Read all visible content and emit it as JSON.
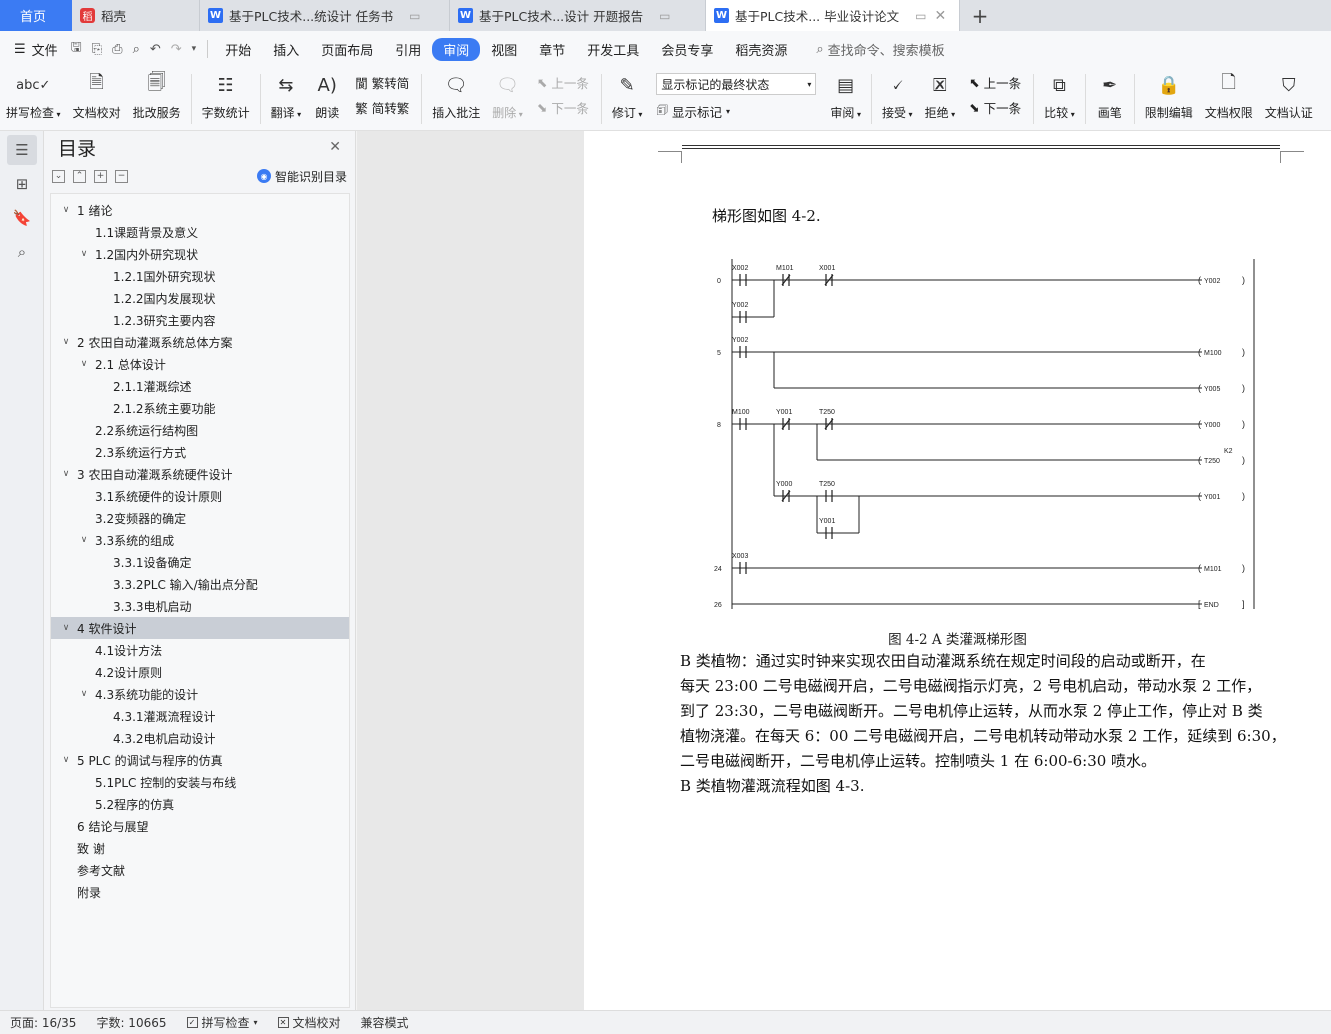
{
  "tabs": {
    "home": "首页",
    "daoke": "稻壳",
    "doc1": "基于PLC技术...统设计 任务书",
    "doc2": "基于PLC技术...设计 开题报告",
    "doc3": "基于PLC技术... 毕业设计论文",
    "new_tab": "+"
  },
  "menu": {
    "file": "文件",
    "items": [
      "开始",
      "插入",
      "页面布局",
      "引用",
      "审阅",
      "视图",
      "章节",
      "开发工具",
      "会员专享",
      "稻壳资源"
    ],
    "active": "审阅",
    "search": "查找命令、搜索模板"
  },
  "ribbon": {
    "spell": "拼写检查",
    "proof": "文档校对",
    "review_service": "批改服务",
    "word_count": "字数统计",
    "translate": "翻译",
    "read_aloud": "朗读",
    "trad_to_simp": "繁转简",
    "simp_to_trad": "简转繁",
    "insert_comment": "插入批注",
    "delete": "删除",
    "prev": "上一条",
    "next": "下一条",
    "track": "修订",
    "display_state": "显示标记的最终状态",
    "show_markup": "显示标记",
    "review": "审阅",
    "accept": "接受",
    "reject": "拒绝",
    "prev2": "上一条",
    "next2": "下一条",
    "compare": "比较",
    "pen": "画笔",
    "restrict": "限制编辑",
    "permission": "文档权限",
    "certify": "文档认证"
  },
  "toc": {
    "title": "目录",
    "smart": "智能识别目录",
    "items": [
      {
        "text": "1   绪论",
        "level": 0,
        "chev": true
      },
      {
        "text": "1.1课题背景及意义",
        "level": 1,
        "chev": false
      },
      {
        "text": "1.2国内外研究现状",
        "level": 1,
        "chev": true
      },
      {
        "text": "1.2.1国外研究现状",
        "level": 2,
        "chev": false
      },
      {
        "text": "1.2.2国内发展现状",
        "level": 2,
        "chev": false
      },
      {
        "text": "1.2.3研究主要内容",
        "level": 2,
        "chev": false
      },
      {
        "text": "2   农田自动灌溉系统总体方案",
        "level": 0,
        "chev": true
      },
      {
        "text": "2.1  总体设计",
        "level": 1,
        "chev": true
      },
      {
        "text": "2.1.1灌溉综述",
        "level": 2,
        "chev": false
      },
      {
        "text": "2.1.2系统主要功能",
        "level": 2,
        "chev": false
      },
      {
        "text": "2.2系统运行结构图",
        "level": 1,
        "chev": false
      },
      {
        "text": "2.3系统运行方式",
        "level": 1,
        "chev": false
      },
      {
        "text": "3   农田自动灌溉系统硬件设计",
        "level": 0,
        "chev": true
      },
      {
        "text": "3.1系统硬件的设计原则",
        "level": 1,
        "chev": false
      },
      {
        "text": "3.2变频器的确定",
        "level": 1,
        "chev": false
      },
      {
        "text": "3.3系统的组成",
        "level": 1,
        "chev": true
      },
      {
        "text": "3.3.1设备确定",
        "level": 2,
        "chev": false
      },
      {
        "text": "3.3.2PLC 输入/输出点分配",
        "level": 2,
        "chev": false
      },
      {
        "text": "3.3.3电机启动",
        "level": 2,
        "chev": false
      },
      {
        "text": "4   软件设计",
        "level": 0,
        "chev": true,
        "selected": true
      },
      {
        "text": "4.1设计方法",
        "level": 1,
        "chev": false
      },
      {
        "text": "4.2设计原则",
        "level": 1,
        "chev": false
      },
      {
        "text": "4.3系统功能的设计",
        "level": 1,
        "chev": true
      },
      {
        "text": "4.3.1灌溉流程设计",
        "level": 2,
        "chev": false
      },
      {
        "text": "4.3.2电机启动设计",
        "level": 2,
        "chev": false
      },
      {
        "text": "5   PLC 的调试与程序的仿真",
        "level": 0,
        "chev": true
      },
      {
        "text": "5.1PLC 控制的安装与布线",
        "level": 1,
        "chev": false
      },
      {
        "text": "5.2程序的仿真",
        "level": 1,
        "chev": false
      },
      {
        "text": "6   结论与展望",
        "level": 0,
        "chev": false
      },
      {
        "text": "致   谢",
        "level": 0,
        "chev": false
      },
      {
        "text": "参考文献",
        "level": 0,
        "chev": false
      },
      {
        "text": "附录",
        "level": 0,
        "chev": false
      }
    ]
  },
  "doc": {
    "intro": "梯形图如图 4-2.",
    "caption": "图 4-2 A 类灌溉梯形图",
    "para_lines": [
      "        B 类植物：通过实时钟来实现农田自动灌溉系统在规定时间段的启动或断开，在",
      "每天 23:00 二号电磁阀开启，二号电磁阀指示灯亮，2 号电机启动，带动水泵 2 工作，",
      "到了 23:30，二号电磁阀断开。二号电机停止运转，从而水泵 2 停止工作，停止对 B 类",
      "植物浇灌。在每天 6：00 二号电磁阀开启，二号电机转动带动水泵 2 工作，延续到 6:30，",
      "二号电磁阀断开，二号电机停止运转。控制喷头 1 在 6:00-6:30 喷水。",
      "        B 类植物灌溉流程如图 4-3."
    ],
    "ladder": {
      "steps": [
        "0",
        "5",
        "8",
        "24",
        "26"
      ],
      "contacts": [
        "X002",
        "M101",
        "X001",
        "Y002",
        "Y002",
        "M100",
        "Y001",
        "T250",
        "Y000",
        "T250",
        "Y001",
        "X003"
      ],
      "coils": [
        "Y002",
        "M100",
        "Y005",
        "Y000",
        "T250",
        "Y001",
        "M101",
        "END"
      ],
      "timer_const": "K2"
    }
  },
  "status": {
    "page": "页面: 16/35",
    "words": "字数: 10665",
    "spell": "拼写检查",
    "proof": "文档校对",
    "compat": "兼容模式"
  }
}
